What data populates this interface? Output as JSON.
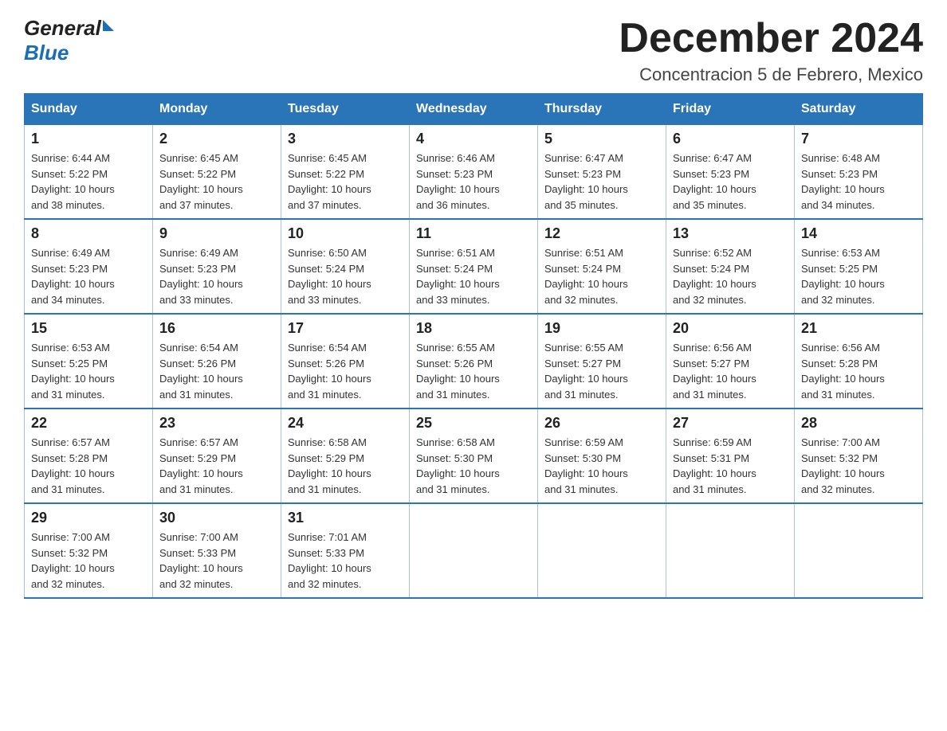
{
  "header": {
    "logo_general": "General",
    "logo_blue": "Blue",
    "month_title": "December 2024",
    "location": "Concentracion 5 de Febrero, Mexico"
  },
  "weekdays": [
    "Sunday",
    "Monday",
    "Tuesday",
    "Wednesday",
    "Thursday",
    "Friday",
    "Saturday"
  ],
  "weeks": [
    [
      {
        "day": "1",
        "sunrise": "6:44 AM",
        "sunset": "5:22 PM",
        "daylight": "10 hours and 38 minutes."
      },
      {
        "day": "2",
        "sunrise": "6:45 AM",
        "sunset": "5:22 PM",
        "daylight": "10 hours and 37 minutes."
      },
      {
        "day": "3",
        "sunrise": "6:45 AM",
        "sunset": "5:22 PM",
        "daylight": "10 hours and 37 minutes."
      },
      {
        "day": "4",
        "sunrise": "6:46 AM",
        "sunset": "5:23 PM",
        "daylight": "10 hours and 36 minutes."
      },
      {
        "day": "5",
        "sunrise": "6:47 AM",
        "sunset": "5:23 PM",
        "daylight": "10 hours and 35 minutes."
      },
      {
        "day": "6",
        "sunrise": "6:47 AM",
        "sunset": "5:23 PM",
        "daylight": "10 hours and 35 minutes."
      },
      {
        "day": "7",
        "sunrise": "6:48 AM",
        "sunset": "5:23 PM",
        "daylight": "10 hours and 34 minutes."
      }
    ],
    [
      {
        "day": "8",
        "sunrise": "6:49 AM",
        "sunset": "5:23 PM",
        "daylight": "10 hours and 34 minutes."
      },
      {
        "day": "9",
        "sunrise": "6:49 AM",
        "sunset": "5:23 PM",
        "daylight": "10 hours and 33 minutes."
      },
      {
        "day": "10",
        "sunrise": "6:50 AM",
        "sunset": "5:24 PM",
        "daylight": "10 hours and 33 minutes."
      },
      {
        "day": "11",
        "sunrise": "6:51 AM",
        "sunset": "5:24 PM",
        "daylight": "10 hours and 33 minutes."
      },
      {
        "day": "12",
        "sunrise": "6:51 AM",
        "sunset": "5:24 PM",
        "daylight": "10 hours and 32 minutes."
      },
      {
        "day": "13",
        "sunrise": "6:52 AM",
        "sunset": "5:24 PM",
        "daylight": "10 hours and 32 minutes."
      },
      {
        "day": "14",
        "sunrise": "6:53 AM",
        "sunset": "5:25 PM",
        "daylight": "10 hours and 32 minutes."
      }
    ],
    [
      {
        "day": "15",
        "sunrise": "6:53 AM",
        "sunset": "5:25 PM",
        "daylight": "10 hours and 31 minutes."
      },
      {
        "day": "16",
        "sunrise": "6:54 AM",
        "sunset": "5:26 PM",
        "daylight": "10 hours and 31 minutes."
      },
      {
        "day": "17",
        "sunrise": "6:54 AM",
        "sunset": "5:26 PM",
        "daylight": "10 hours and 31 minutes."
      },
      {
        "day": "18",
        "sunrise": "6:55 AM",
        "sunset": "5:26 PM",
        "daylight": "10 hours and 31 minutes."
      },
      {
        "day": "19",
        "sunrise": "6:55 AM",
        "sunset": "5:27 PM",
        "daylight": "10 hours and 31 minutes."
      },
      {
        "day": "20",
        "sunrise": "6:56 AM",
        "sunset": "5:27 PM",
        "daylight": "10 hours and 31 minutes."
      },
      {
        "day": "21",
        "sunrise": "6:56 AM",
        "sunset": "5:28 PM",
        "daylight": "10 hours and 31 minutes."
      }
    ],
    [
      {
        "day": "22",
        "sunrise": "6:57 AM",
        "sunset": "5:28 PM",
        "daylight": "10 hours and 31 minutes."
      },
      {
        "day": "23",
        "sunrise": "6:57 AM",
        "sunset": "5:29 PM",
        "daylight": "10 hours and 31 minutes."
      },
      {
        "day": "24",
        "sunrise": "6:58 AM",
        "sunset": "5:29 PM",
        "daylight": "10 hours and 31 minutes."
      },
      {
        "day": "25",
        "sunrise": "6:58 AM",
        "sunset": "5:30 PM",
        "daylight": "10 hours and 31 minutes."
      },
      {
        "day": "26",
        "sunrise": "6:59 AM",
        "sunset": "5:30 PM",
        "daylight": "10 hours and 31 minutes."
      },
      {
        "day": "27",
        "sunrise": "6:59 AM",
        "sunset": "5:31 PM",
        "daylight": "10 hours and 31 minutes."
      },
      {
        "day": "28",
        "sunrise": "7:00 AM",
        "sunset": "5:32 PM",
        "daylight": "10 hours and 32 minutes."
      }
    ],
    [
      {
        "day": "29",
        "sunrise": "7:00 AM",
        "sunset": "5:32 PM",
        "daylight": "10 hours and 32 minutes."
      },
      {
        "day": "30",
        "sunrise": "7:00 AM",
        "sunset": "5:33 PM",
        "daylight": "10 hours and 32 minutes."
      },
      {
        "day": "31",
        "sunrise": "7:01 AM",
        "sunset": "5:33 PM",
        "daylight": "10 hours and 32 minutes."
      },
      null,
      null,
      null,
      null
    ]
  ],
  "labels": {
    "sunrise": "Sunrise:",
    "sunset": "Sunset:",
    "daylight": "Daylight:"
  }
}
